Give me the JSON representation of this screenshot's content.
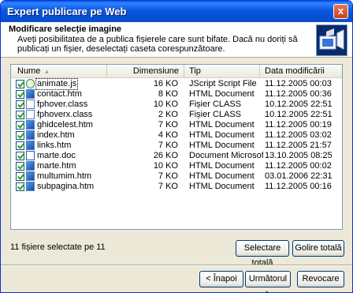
{
  "window": {
    "title": "Expert publicare pe Web",
    "close_glyph": "x"
  },
  "header": {
    "title": "Modificare selecție imagine",
    "description": "Aveți posibilitatea de a publica fișierele care sunt bifate. Dacă nu doriți să publicați un fișier, deselectați caseta corespunzătoare.",
    "icon": "publish-wizard-icon"
  },
  "columns": {
    "name": "Nume",
    "size": "Dimensiune",
    "type": "Tip",
    "date": "Data modificării"
  },
  "files": [
    {
      "name": "animate.js",
      "size": "16 KO",
      "type": "JScript Script File",
      "date": "11.12.2005 00:03",
      "icon": "js",
      "checked": true,
      "focused": true
    },
    {
      "name": "contact.htm",
      "size": "8 KO",
      "type": "HTML Document",
      "date": "11.12.2005 00:36",
      "icon": "htm",
      "checked": true
    },
    {
      "name": "fphover.class",
      "size": "10 KO",
      "type": "Fișier CLASS",
      "date": "10.12.2005 22:51",
      "icon": "class",
      "checked": true
    },
    {
      "name": "fphoverx.class",
      "size": "2 KO",
      "type": "Fișier CLASS",
      "date": "10.12.2005 22:51",
      "icon": "class",
      "checked": true
    },
    {
      "name": "ghidcelest.htm",
      "size": "7 KO",
      "type": "HTML Document",
      "date": "11.12.2005 00:19",
      "icon": "htm",
      "checked": true
    },
    {
      "name": "index.htm",
      "size": "4 KO",
      "type": "HTML Document",
      "date": "11.12.2005 03:02",
      "icon": "htm",
      "checked": true
    },
    {
      "name": "links.htm",
      "size": "7 KO",
      "type": "HTML Document",
      "date": "11.12.2005 21:57",
      "icon": "htm",
      "checked": true
    },
    {
      "name": "marte.doc",
      "size": "26 KO",
      "type": "Document Microsoft...",
      "date": "13.10.2005 08:25",
      "icon": "doc",
      "checked": true
    },
    {
      "name": "marte.htm",
      "size": "10 KO",
      "type": "HTML Document",
      "date": "11.12.2005 00:02",
      "icon": "htm",
      "checked": true
    },
    {
      "name": "multumim.htm",
      "size": "7 KO",
      "type": "HTML Document",
      "date": "03.01.2006 22:31",
      "icon": "htm",
      "checked": true
    },
    {
      "name": "subpagina.htm",
      "size": "7 KO",
      "type": "HTML Document",
      "date": "11.12.2005 00:16",
      "icon": "htm",
      "checked": true
    }
  ],
  "status": "11 fișiere selectate pe 11",
  "buttons": {
    "select_all": "Selectare totală",
    "clear_all": "Golire totală",
    "back": "< Înapoi",
    "next": "Următorul >",
    "cancel": "Revocare"
  }
}
